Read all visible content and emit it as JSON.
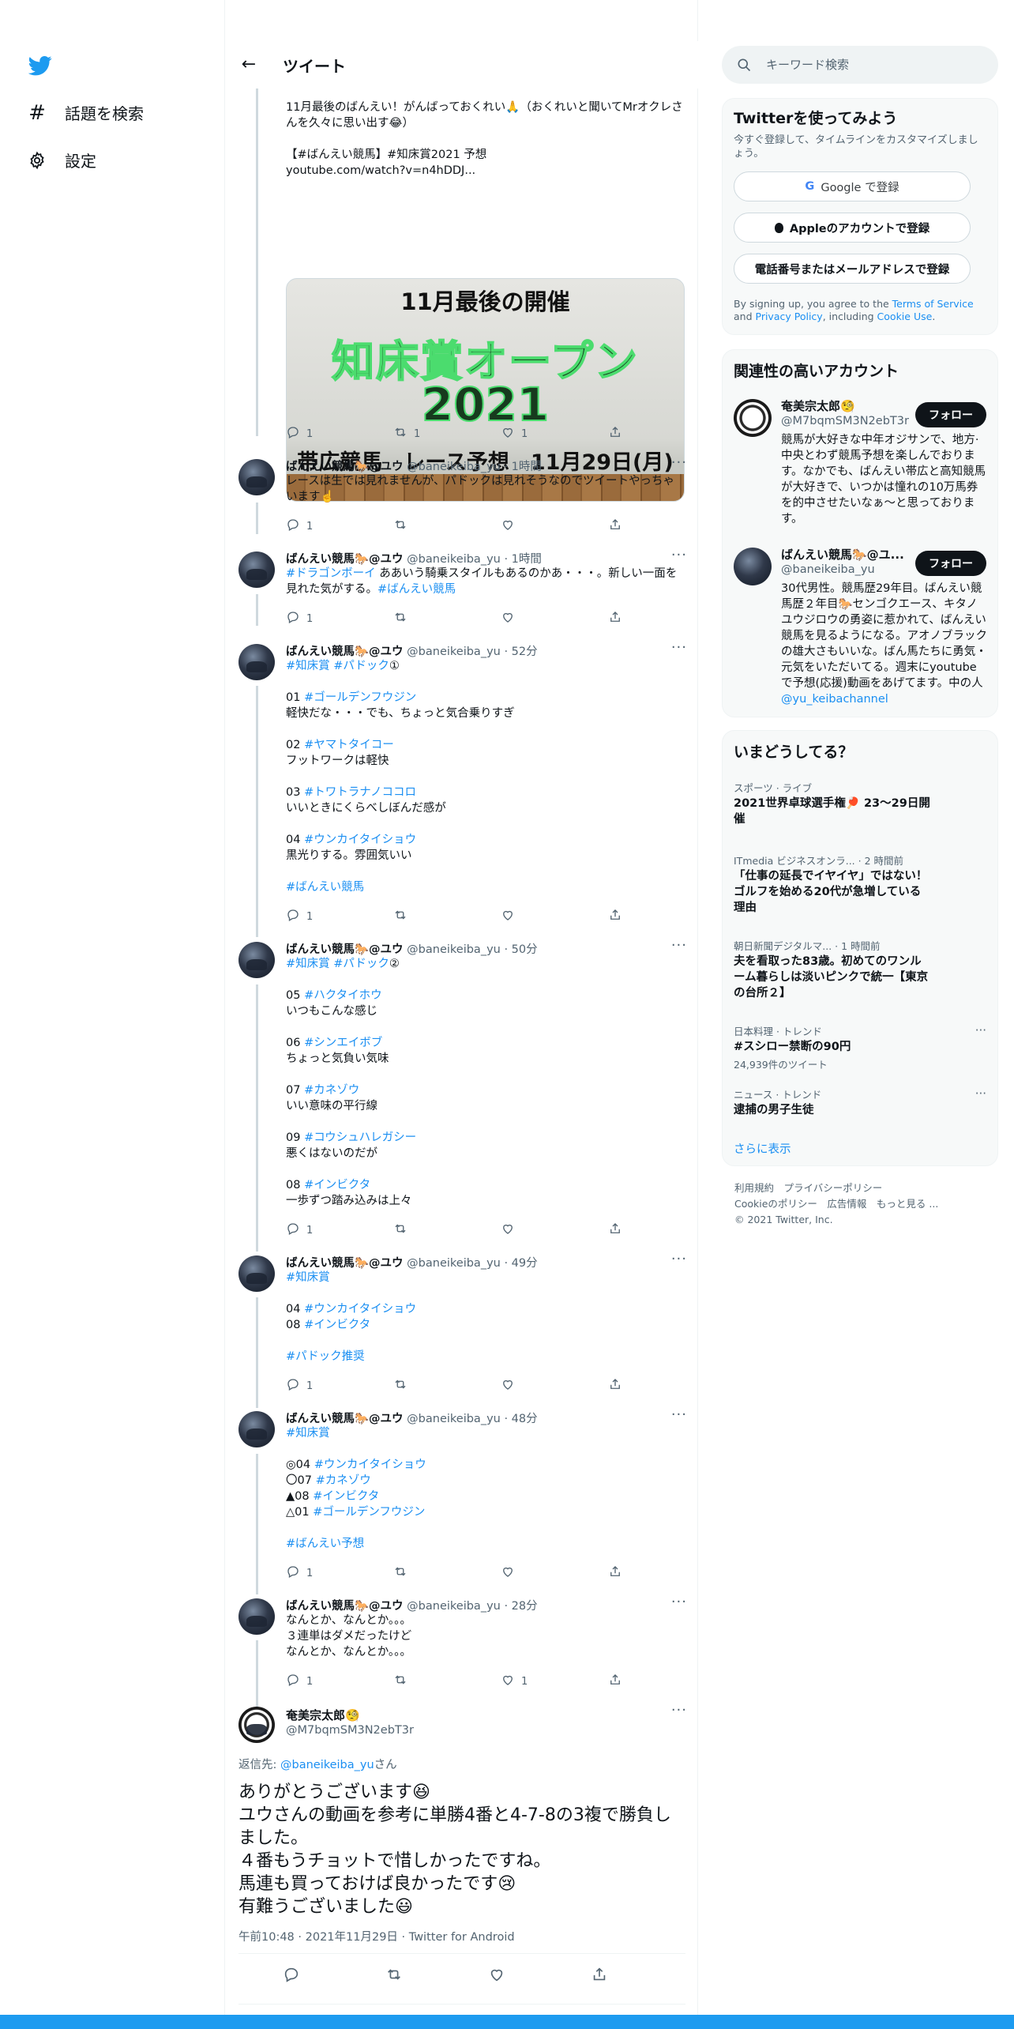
{
  "nav": {
    "explore": "話題を検索",
    "settings": "設定"
  },
  "header": {
    "title": "ツイート"
  },
  "tweets": [
    {
      "body": "11月最後のばんえい！がんばっておくれい🙏（おくれいと聞いてMrオクレさんを久々に思い出す😂）\n\n【#ばんえい競馬】#知床賞2021 予想\nyoutube.com/watch?v=n4hDDJ...",
      "media": {
        "line1": "11月最後の開催",
        "line2": "知床賞オープン",
        "line3": "2021",
        "line4": "帯広競馬　レース予想　11月29日(月)"
      },
      "reply": "1",
      "retweet": "1",
      "like": "1"
    },
    {
      "name": "ばんえい競馬🐎@ユウ",
      "handle": "@baneikeiba_yu · 1時間",
      "body": "レースは生では見れませんが、パドックは見れそうなのでツイートやっちゃいます☝️",
      "reply": "1",
      "retweet": "",
      "like": ""
    },
    {
      "name": "ばんえい競馬🐎@ユウ",
      "handle": "@baneikeiba_yu · 1時間",
      "body_parts": [
        "#ドラゴンボーイ",
        " ああいう騎乗スタイルもあるのかあ・・・。新しい一面を見れた気がする。",
        "#ばんえい競馬"
      ],
      "reply": "1",
      "retweet": "",
      "like": ""
    },
    {
      "name": "ばんえい競馬🐎@ユウ",
      "handle": "@baneikeiba_yu · 52分",
      "lines": [
        {
          "tag": "#知床賞 #パドック",
          "text": "①"
        },
        {
          "tag": "",
          "text": ""
        },
        {
          "tag": "#ゴールデンフウジン",
          "text": "01 "
        },
        {
          "tag": "",
          "text": "軽快だな・・・でも、ちょっと気合乗りすぎ"
        },
        {
          "tag": "",
          "text": ""
        },
        {
          "tag": "#ヤマトタイコー",
          "text": "02 "
        },
        {
          "tag": "",
          "text": "フットワークは軽快"
        },
        {
          "tag": "",
          "text": ""
        },
        {
          "tag": "#トワトラナノココロ",
          "text": "03 "
        },
        {
          "tag": "",
          "text": "いいときにくらべしぼんだ感が"
        },
        {
          "tag": "",
          "text": ""
        },
        {
          "tag": "#ウンカイタイショウ",
          "text": "04 "
        },
        {
          "tag": "",
          "text": "黒光りする。雰囲気いい"
        },
        {
          "tag": "",
          "text": ""
        },
        {
          "tag": "#ばんえい競馬",
          "text": ""
        }
      ],
      "reply": "1",
      "retweet": "",
      "like": ""
    },
    {
      "name": "ばんえい競馬🐎@ユウ",
      "handle": "@baneikeiba_yu · 50分",
      "lines": [
        {
          "tag": "#知床賞 #パドック",
          "text": "②"
        },
        {
          "tag": "",
          "text": ""
        },
        {
          "tag": "#ハクタイホウ",
          "text": "05 "
        },
        {
          "tag": "",
          "text": "いつもこんな感じ"
        },
        {
          "tag": "",
          "text": ""
        },
        {
          "tag": "#シンエイボブ",
          "text": "06 "
        },
        {
          "tag": "",
          "text": "ちょっと気負い気味"
        },
        {
          "tag": "",
          "text": ""
        },
        {
          "tag": "#カネゾウ",
          "text": "07 "
        },
        {
          "tag": "",
          "text": "いい意味の平行線"
        },
        {
          "tag": "",
          "text": ""
        },
        {
          "tag": "#コウシュハレガシー",
          "text": "09 "
        },
        {
          "tag": "",
          "text": "悪くはないのだが"
        },
        {
          "tag": "",
          "text": ""
        },
        {
          "tag": "#インビクタ",
          "text": "08 "
        },
        {
          "tag": "",
          "text": "一歩ずつ踏み込みは上々"
        }
      ],
      "reply": "1",
      "retweet": "",
      "like": ""
    },
    {
      "name": "ばんえい競馬🐎@ユウ",
      "handle": "@baneikeiba_yu · 49分",
      "lines": [
        {
          "tag": "#知床賞",
          "text": ""
        },
        {
          "tag": "",
          "text": ""
        },
        {
          "tag": "#ウンカイタイショウ",
          "text": "04 "
        },
        {
          "tag": "#インビクタ",
          "text": "08 "
        },
        {
          "tag": "",
          "text": ""
        },
        {
          "tag": "#パドック推奨",
          "text": ""
        }
      ],
      "reply": "1",
      "retweet": "",
      "like": ""
    },
    {
      "name": "ばんえい競馬🐎@ユウ",
      "handle": "@baneikeiba_yu · 48分",
      "lines": [
        {
          "tag": "#知床賞",
          "text": ""
        },
        {
          "tag": "",
          "text": ""
        },
        {
          "tag": "#ウンカイタイショウ",
          "text": "◎04 "
        },
        {
          "tag": "#カネゾウ",
          "text": "〇07 "
        },
        {
          "tag": "#インビクタ",
          "text": "▲08 "
        },
        {
          "tag": "#ゴールデンフウジン",
          "text": "△01 "
        },
        {
          "tag": "",
          "text": ""
        },
        {
          "tag": "#ばんえい予想",
          "text": ""
        }
      ],
      "reply": "1",
      "retweet": "",
      "like": ""
    },
    {
      "name": "ばんえい競馬🐎@ユウ",
      "handle": "@baneikeiba_yu · 28分",
      "body": "なんとか、なんとか。。。\n３連単はダメだったけど\nなんとか、なんとか。。。",
      "reply": "1",
      "retweet": "",
      "like": "1"
    }
  ],
  "focused": {
    "name": "奄美宗太郎🧐",
    "handle": "@M7bqmSM3N2ebT3r",
    "reply_prefix": "返信先: ",
    "reply_to": "@baneikeiba_yu",
    "reply_suffix": "さん",
    "body": "ありがとうございます😆\nユウさんの動画を参考に単勝4番と4-7-8の3複で勝負しました。\n４番もうチョットで惜しかったですね。\n馬連も買っておけば良かったです😢\n有難うございました😃",
    "meta": "午前10:48 · 2021年11月29日 · Twitter for Android"
  },
  "search": {
    "placeholder": "キーワード検索"
  },
  "signup": {
    "title": "Twitterを使ってみよう",
    "subtitle": "今すぐ登録して、タイムラインをカスタマイズしましょう。",
    "google": "Google で登録",
    "apple": "Appleのアカウントで登録",
    "phone": "電話番号またはメールアドレスで登録",
    "fine_1": "By signing up, you agree to the ",
    "fine_tos": "Terms of Service",
    "fine_2": " and ",
    "fine_pp": "Privacy Policy",
    "fine_3": ", including ",
    "fine_cookie": "Cookie Use",
    "fine_4": "."
  },
  "relevant": {
    "title": "関連性の高いアカウント",
    "follow_label": "フォロー",
    "accounts": [
      {
        "name": "奄美宗太郎🧐",
        "handle": "@M7bqmSM3N2ebT3r",
        "bio": "競馬が大好きな中年オジサンで、地方·中央とわず競馬予想を楽しんでおります。なかでも、ばんえい帯広と高知競馬が大好きで、いつかは憧れの10万馬券を的中させたいなぁ～と思っております。"
      },
      {
        "name": "ばんえい競馬🐎@ユ...",
        "handle": "@baneikeiba_yu",
        "bio": "30代男性。競馬歴29年目。ばんえい競馬歴２年目🐎センゴクエース、キタノユウジロウの勇姿に惹かれて、ばんえい競馬を見るようになる。アオノブラックの雄大さもいいな。ばん馬たちに勇気・元気をいただいてる。週末にyoutubeで予想(応援)動画をあげてます。中の人",
        "bio_link": "@yu_keibachannel"
      }
    ]
  },
  "trends": {
    "title": "いまどうしてる？",
    "items": [
      {
        "cat": "スポーツ · ライブ",
        "title": "2021世界卓球選手権🏓 23〜29日開催",
        "count": ""
      },
      {
        "cat": "ITmedia ビジネスオンラ... · 2 時間前",
        "title": "「仕事の延長でイヤイヤ」ではない！　ゴルフを始める20代が急増している理由",
        "count": ""
      },
      {
        "cat": "朝日新聞デジタルマ... · 1 時間前",
        "title": "夫を看取った83歳。初めてのワンルーム暮らしは淡いピンクで統一【東京の台所２】",
        "count": ""
      },
      {
        "cat": "日本料理 · トレンド",
        "title": "#スシロー禁断の90円",
        "count": "24,939件のツイート"
      },
      {
        "cat": "ニュース · トレンド",
        "title": "逮捕の男子生徒",
        "count": ""
      }
    ],
    "show_more": "さらに表示"
  },
  "footer": {
    "line1": "利用規約　プライバシーポリシー",
    "line2": "Cookieのポリシー　広告情報　もっと見る ...",
    "line3": "© 2021 Twitter, Inc."
  },
  "colors": {
    "accent": "#1d9bf0",
    "link": "#1b8ff2",
    "text": "#0f1419",
    "muted": "#536471"
  }
}
